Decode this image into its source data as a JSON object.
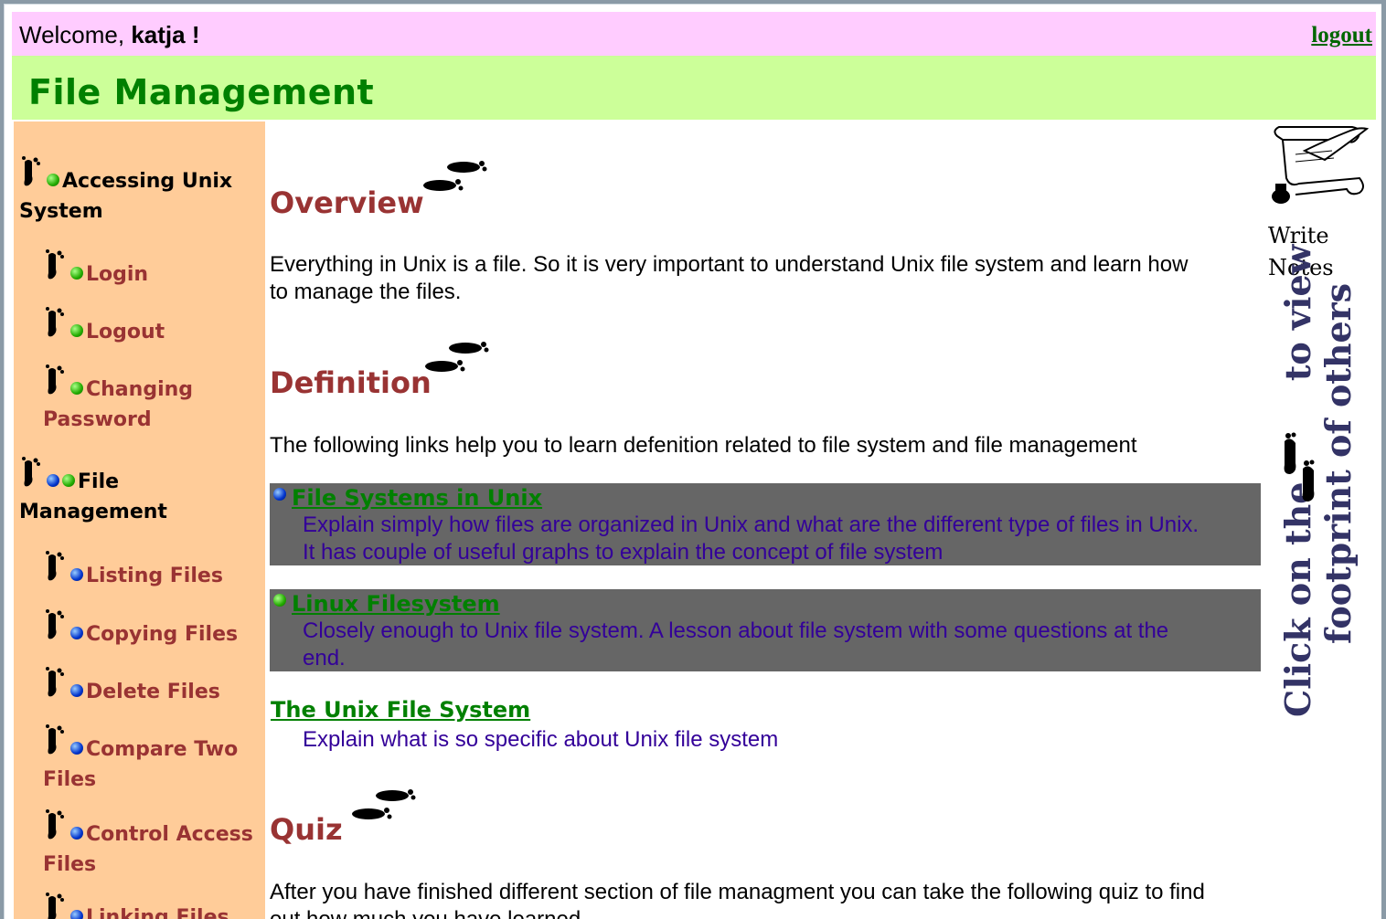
{
  "header": {
    "welcome_prefix": "Welcome,",
    "username": "katja",
    "welcome_suffix": "!",
    "logout_label": "logout"
  },
  "page_title": "File Management",
  "sidebar": {
    "items": [
      {
        "label_line1": "Accessing Unix",
        "label_line2": "System",
        "level": "top",
        "dots": [
          "green"
        ]
      },
      {
        "label_line1": "Login",
        "label_line2": "",
        "level": "sub",
        "dots": [
          "green"
        ]
      },
      {
        "label_line1": "Logout",
        "label_line2": "",
        "level": "sub",
        "dots": [
          "green"
        ]
      },
      {
        "label_line1": "Changing",
        "label_line2": "Password",
        "level": "sub",
        "dots": [
          "green"
        ]
      },
      {
        "label_line1": "File",
        "label_line2": "Management",
        "level": "top",
        "dots": [
          "blue",
          "green"
        ]
      },
      {
        "label_line1": "Listing Files",
        "label_line2": "",
        "level": "sub",
        "dots": [
          "blue"
        ]
      },
      {
        "label_line1": "Copying Files",
        "label_line2": "",
        "level": "sub",
        "dots": [
          "blue"
        ]
      },
      {
        "label_line1": "Delete Files",
        "label_line2": "",
        "level": "sub",
        "dots": [
          "blue"
        ]
      },
      {
        "label_line1": "Compare Two",
        "label_line2": "Files",
        "level": "sub",
        "dots": [
          "blue"
        ]
      },
      {
        "label_line1": "Control Access",
        "label_line2": "Files",
        "level": "sub",
        "dots": [
          "blue"
        ]
      },
      {
        "label_line1": "Linking Files",
        "label_line2": "",
        "level": "sub",
        "dots": [
          "blue"
        ]
      }
    ]
  },
  "sections": {
    "overview": {
      "heading": "Overview",
      "text_line1": "Everything in Unix is a file. So it is very important to understand Unix file system and learn how",
      "text_line2": "to manage the files."
    },
    "definition": {
      "heading": "Definition",
      "text": "The following links help you to learn defenition related to file system and file management",
      "links": [
        {
          "title": "File Systems in Unix",
          "desc_line1": "Explain simply how files are organized in Unix and what are the different type of files in Unix.",
          "desc_line2": "It has couple of useful graphs to explain the concept of file system",
          "dot": "blue",
          "highlighted": true
        },
        {
          "title": "Linux Filesystem",
          "desc_line1": "Closely enough to Unix file system. A lesson about file system with some questions at the",
          "desc_line2": "end.",
          "dot": "green",
          "highlighted": true
        },
        {
          "title": "The Unix File System",
          "desc_line1": "Explain what is so specific about Unix file system",
          "desc_line2": "",
          "dot": "",
          "highlighted": false
        }
      ]
    },
    "quiz": {
      "heading": "Quiz",
      "text_line1": "After you have finished different section of file managment you can take the following quiz to find",
      "text_line2": "out how much you have learned."
    }
  },
  "notes": {
    "label_line1": "Write",
    "label_line2": "Notes"
  },
  "footprint_link": {
    "line1": "Click on the",
    "line1b": "to view",
    "line2": "footprint of others"
  },
  "colors": {
    "welcome_bg": "#ffccff",
    "title_bg": "#ccff99",
    "sidebar_bg": "#ffcc99",
    "heading": "#993333",
    "link_box_bg": "#666666",
    "link_title": "#008000",
    "link_desc": "#330099"
  }
}
